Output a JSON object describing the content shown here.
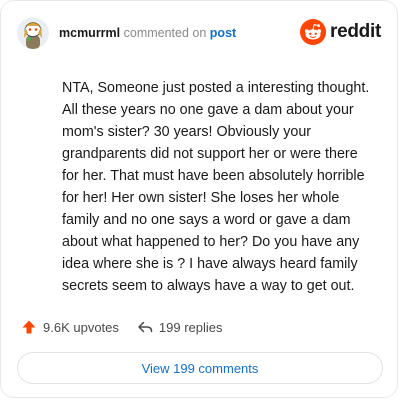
{
  "header": {
    "username": "mcmurrml",
    "commented_on": "commented on",
    "post_link": "post",
    "brand": "reddit",
    "brand_color": "#ff4500"
  },
  "comment": {
    "lines": [
      "NTA, Someone just posted a interesting thought.",
      "All these years no one gave a dam about your",
      "mom's sister? 30 years! Obviously your",
      "grandparents did not support her or were there",
      "for her. That must have been absolutely horrible",
      "for her! Her own sister! She loses her whole",
      "family and no one says a word or gave a dam",
      "about what happened to her? Do you have any",
      "idea where she is ? I have always heard family",
      "secrets seem to always have a way to get out."
    ]
  },
  "actions": {
    "upvotes": "9.6K upvotes",
    "replies": "199 replies",
    "upvote_icon": "upvote-arrow-icon",
    "reply_icon": "reply-arrow-icon",
    "upvote_color": "#ff4500"
  },
  "footer": {
    "view_comments": "View 199 comments",
    "link_color": "#1170cf"
  }
}
